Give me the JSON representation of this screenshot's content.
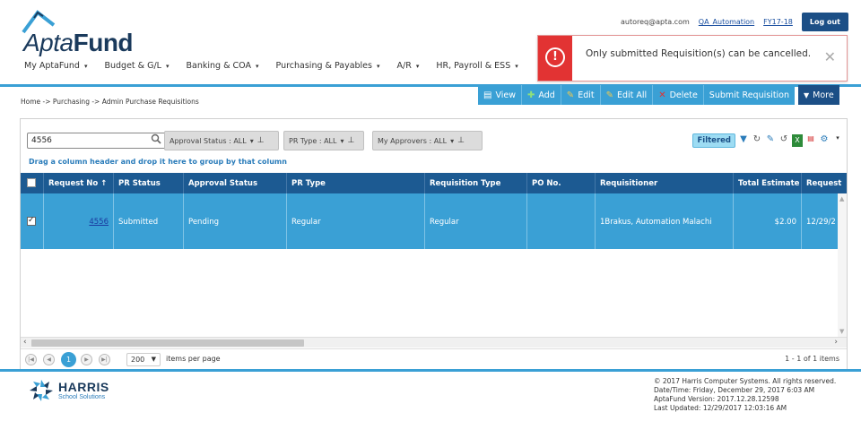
{
  "app": {
    "logo_part1": "Apta",
    "logo_part2": "Fund"
  },
  "user": {
    "email": "autoreq@apta.com",
    "profile": "QA_Automation",
    "fiscal_year": "FY17-18",
    "logout": "Log out"
  },
  "nav": [
    {
      "label": "My AptaFund",
      "caret": "▾"
    },
    {
      "label": "Budget & G/L",
      "caret": "▾"
    },
    {
      "label": "Banking & COA",
      "caret": "▾"
    },
    {
      "label": "Purchasing & Payables",
      "caret": "▾"
    },
    {
      "label": "A/R",
      "caret": "▾"
    },
    {
      "label": "HR, Payroll & ESS",
      "caret": "▾"
    }
  ],
  "toast": {
    "message": "Only submitted Requisition(s) can be cancelled.",
    "icon": "!",
    "close": "✕"
  },
  "breadcrumb": "Home -> Purchasing -> Admin Purchase Requisitions",
  "toolbar": {
    "view": "View",
    "add": "Add",
    "edit": "Edit",
    "edit_all": "Edit All",
    "delete": "Delete",
    "submit": "Submit Requisition",
    "more": "More"
  },
  "filters": {
    "search_value": "4556",
    "approval_status": "Approval Status : ALL",
    "pr_type": "PR Type : ALL",
    "my_approvers": "My Approvers : ALL",
    "filtered": "Filtered",
    "group_hint": "Drag a column header and drop it here to group by that column"
  },
  "table": {
    "columns": [
      "Request No",
      "PR Status",
      "Approval Status",
      "PR Type",
      "Requisition Type",
      "PO No.",
      "Requisitioner",
      "Total Estimate",
      "Request"
    ],
    "sort_indicator": "↑",
    "rows": [
      {
        "request_no": "4556",
        "pr_status": "Submitted",
        "approval_status": "Pending",
        "pr_type": "Regular",
        "requisition_type": "Regular",
        "po_no": "",
        "requisitioner": "1Brakus, Automation Malachi",
        "total_estimate": "$2.00",
        "request_date": "12/29/2"
      }
    ]
  },
  "pager": {
    "current_page": "1",
    "page_size": "200",
    "per_page_label": "items per page",
    "info": "1 - 1 of 1 items"
  },
  "footer": {
    "company": "HARRIS",
    "company_sub": "School Solutions",
    "copyright": "© 2017 Harris Computer Systems. All rights reserved.",
    "datetime": "Date/Time: Friday, December 29, 2017 6:03 AM",
    "version": "AptaFund Version: 2017.12.28.12598",
    "last_updated": "Last Updated: 12/29/2017 12:03:16 AM"
  },
  "colors": {
    "accent": "#3aa0d5",
    "header_dark": "#1c5a92",
    "brand_navy": "#1a3a5c",
    "error": "#e23333"
  }
}
